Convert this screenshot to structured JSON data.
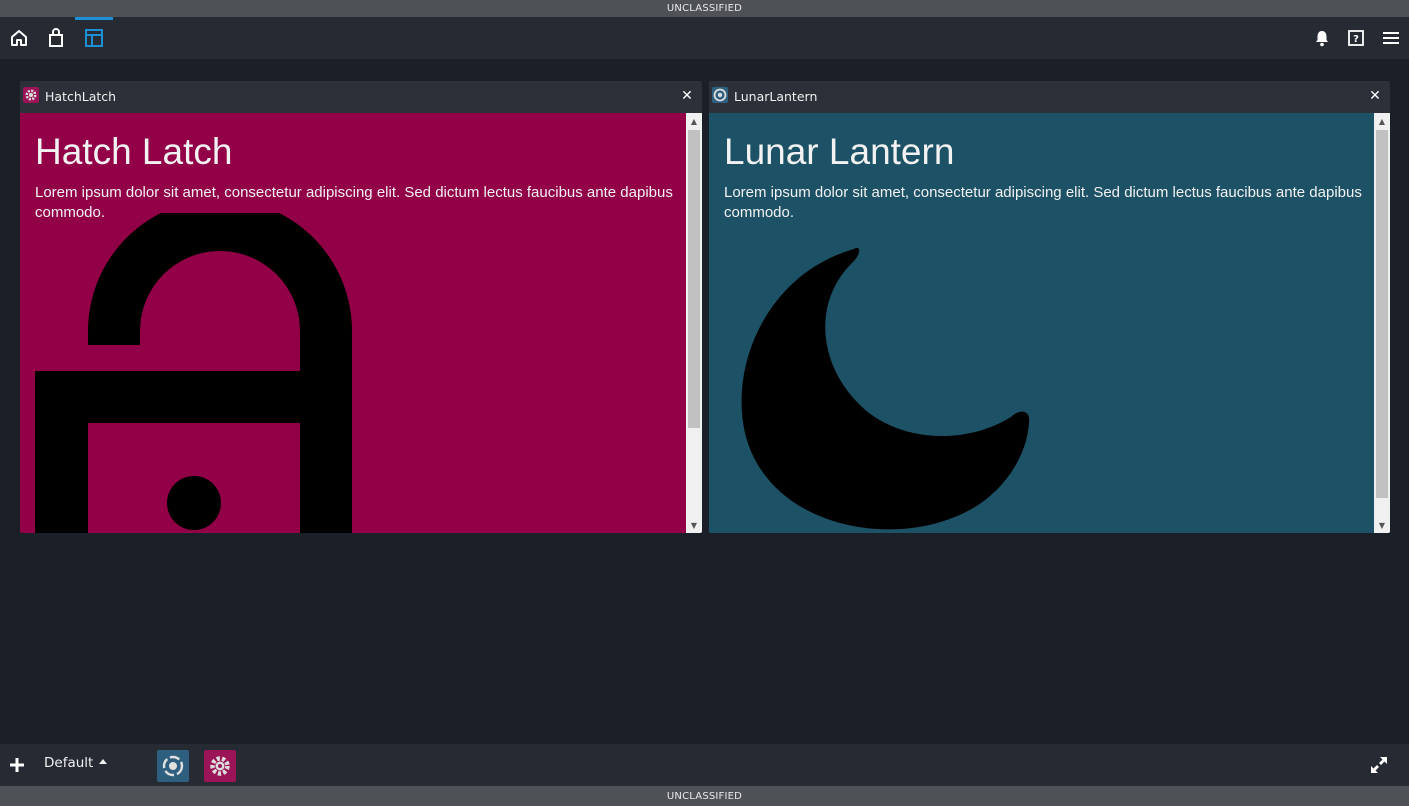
{
  "classification": "UNCLASSIFIED",
  "topbar": {
    "left_icons": [
      "home-icon",
      "shopping-bag-icon",
      "layout-icon"
    ],
    "active_icon": "layout-icon",
    "right_icons": [
      "bell-icon",
      "help-icon",
      "menu-icon"
    ],
    "accent": "#1d8fd6"
  },
  "widgets": [
    {
      "tab_title": "HatchLatch",
      "heading": "Hatch Latch",
      "body": "Lorem ipsum dolor sit amet, consectetur adipiscing elit. Sed dictum lectus faucibus ante dapibus commodo.",
      "background": "#920048",
      "icon": "unlock-icon"
    },
    {
      "tab_title": "LunarLantern",
      "heading": "Lunar Lantern",
      "body": "Lorem ipsum dolor sit amet, consectetur adipiscing elit. Sed dictum lectus faucibus ante dapibus commodo.",
      "background": "#1c5166",
      "icon": "moon-icon"
    }
  ],
  "bottombar": {
    "layout_name": "Default",
    "tray": [
      {
        "name": "LunarLantern",
        "color": "#2f5f7f"
      },
      {
        "name": "HatchLatch",
        "color": "#9a1457"
      }
    ]
  }
}
